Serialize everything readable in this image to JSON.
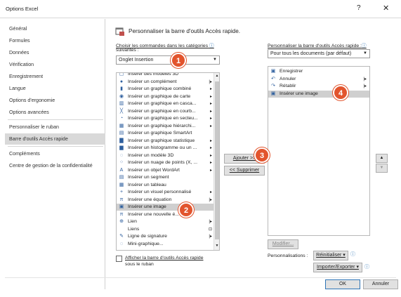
{
  "window": {
    "title": "Options Excel",
    "help": "?",
    "close": "✕"
  },
  "sidebar": {
    "items": [
      {
        "label": "Général"
      },
      {
        "label": "Formules"
      },
      {
        "label": "Données"
      },
      {
        "label": "Vérification"
      },
      {
        "label": "Enregistrement"
      },
      {
        "label": "Langue"
      },
      {
        "label": "Options d'ergonomie"
      },
      {
        "label": "Options avancées"
      },
      {
        "label": "Personnaliser le ruban"
      },
      {
        "label": "Barre d'outils Accès rapide",
        "selected": true
      },
      {
        "label": "Compléments"
      },
      {
        "label": "Centre de gestion de la confidentialité"
      }
    ]
  },
  "main": {
    "heading": "Personnaliser la barre d'outils Accès rapide.",
    "choose_label_1": "Choisir les commandes dans les catégories",
    "choose_label_2": "suivantes :",
    "choose_value": "Onglet Insertion",
    "customize_label": "Personnaliser la barre d'outils Accès rapide :",
    "customize_value": "Pour tous les documents (par défaut)",
    "commands": [
      {
        "label": "Insérer des modèles 3D",
        "icon": "3d-icon",
        "glyph": "▢",
        "sub": ""
      },
      {
        "label": "Insérer un complément",
        "icon": "addin-icon",
        "glyph": "●",
        "sub": "|▸"
      },
      {
        "label": "Insérer un graphique combiné",
        "icon": "combo-chart-icon",
        "glyph": "▮",
        "sub": "▸"
      },
      {
        "label": "Insérer un graphique de carte",
        "icon": "map-chart-icon",
        "glyph": "◉",
        "sub": "▸"
      },
      {
        "label": "Insérer un graphique en casca...",
        "icon": "waterfall-chart-icon",
        "glyph": "▥",
        "sub": "▸"
      },
      {
        "label": "Insérer un graphique en courb...",
        "icon": "line-chart-icon",
        "glyph": "╳",
        "sub": "▸"
      },
      {
        "label": "Insérer un graphique en secteu...",
        "icon": "pie-chart-icon",
        "glyph": "◔",
        "sub": "▸"
      },
      {
        "label": "Insérer un graphique hiérarchi...",
        "icon": "hierarchy-chart-icon",
        "glyph": "▦",
        "sub": "▸"
      },
      {
        "label": "Insérer un graphique SmartArt",
        "icon": "smartart-icon",
        "glyph": "▤",
        "sub": ""
      },
      {
        "label": "Insérer un graphique statistique",
        "icon": "stat-chart-icon",
        "glyph": "▇",
        "sub": "▸"
      },
      {
        "label": "Insérer un histogramme ou un ...",
        "icon": "histogram-icon",
        "glyph": "▆",
        "sub": "▸"
      },
      {
        "label": "Insérer un modèle 3D",
        "icon": "3d-model-icon",
        "glyph": "◌",
        "sub": "▸"
      },
      {
        "label": "Insérer un nuage de points (X, ...",
        "icon": "scatter-icon",
        "glyph": "⁘",
        "sub": "▸"
      },
      {
        "label": "Insérer un objet WordArt",
        "icon": "wordart-icon",
        "glyph": "A",
        "sub": "▸"
      },
      {
        "label": "Insérer un segment",
        "icon": "slicer-icon",
        "glyph": "▤",
        "sub": ""
      },
      {
        "label": "Insérer un tableau",
        "icon": "table-icon",
        "glyph": "▦",
        "sub": ""
      },
      {
        "label": "Insérer un visuel personnalisé",
        "icon": "custom-visual-icon",
        "glyph": "+",
        "sub": "▸"
      },
      {
        "label": "Insérer une équation",
        "icon": "equation-icon",
        "glyph": "π",
        "sub": "|▸"
      },
      {
        "label": "Insérer une image",
        "icon": "image-icon",
        "glyph": "▣",
        "sub": "",
        "selected": true
      },
      {
        "label": "Insérer une nouvelle é...",
        "icon": "new-equation-icon",
        "glyph": "π",
        "sub": ""
      },
      {
        "label": "Lien",
        "icon": "link-icon",
        "glyph": "⊕",
        "sub": "|▸"
      },
      {
        "label": "Liens",
        "icon": "links-icon",
        "glyph": "",
        "sub": "⊡"
      },
      {
        "label": "Ligne de signature",
        "icon": "signature-icon",
        "glyph": "✎",
        "sub": "|▸"
      },
      {
        "label": "Mini-graphique...",
        "icon": "sparkline-icon",
        "glyph": "◌",
        "sub": ""
      }
    ],
    "qat_items": [
      {
        "label": "Enregistrer",
        "icon": "save-icon",
        "glyph": "▣",
        "sub": ""
      },
      {
        "label": "Annuler",
        "icon": "undo-icon",
        "glyph": "↶",
        "sub": "|▸"
      },
      {
        "label": "Rétablir",
        "icon": "redo-icon",
        "glyph": "↷",
        "sub": "|▸"
      },
      {
        "label": "Insérer une image",
        "icon": "image-icon",
        "glyph": "▣",
        "sub": "",
        "selected": true
      }
    ],
    "add_button": "Ajouter >>",
    "remove_button": "<< Supprimer",
    "modify_button": "Modifier...",
    "show_below_1": "Afficher la barre d'outils Accès rapide",
    "show_below_2": "sous le ruban",
    "personalizations_label": "Personnalisations :",
    "reset_button": "Réinitialiser ▾",
    "import_export_button": "Importer/Exporter ▾",
    "ok_button": "OK",
    "cancel_button": "Annuler",
    "up_arrow": "▲",
    "down_arrow": "▼"
  },
  "badges": [
    "1",
    "2",
    "3",
    "4"
  ],
  "colors": {
    "badge": "#e2542d",
    "selection": "#cfcfcf",
    "sidebar_selected": "#d9d9d9",
    "info": "#2e75b6"
  }
}
